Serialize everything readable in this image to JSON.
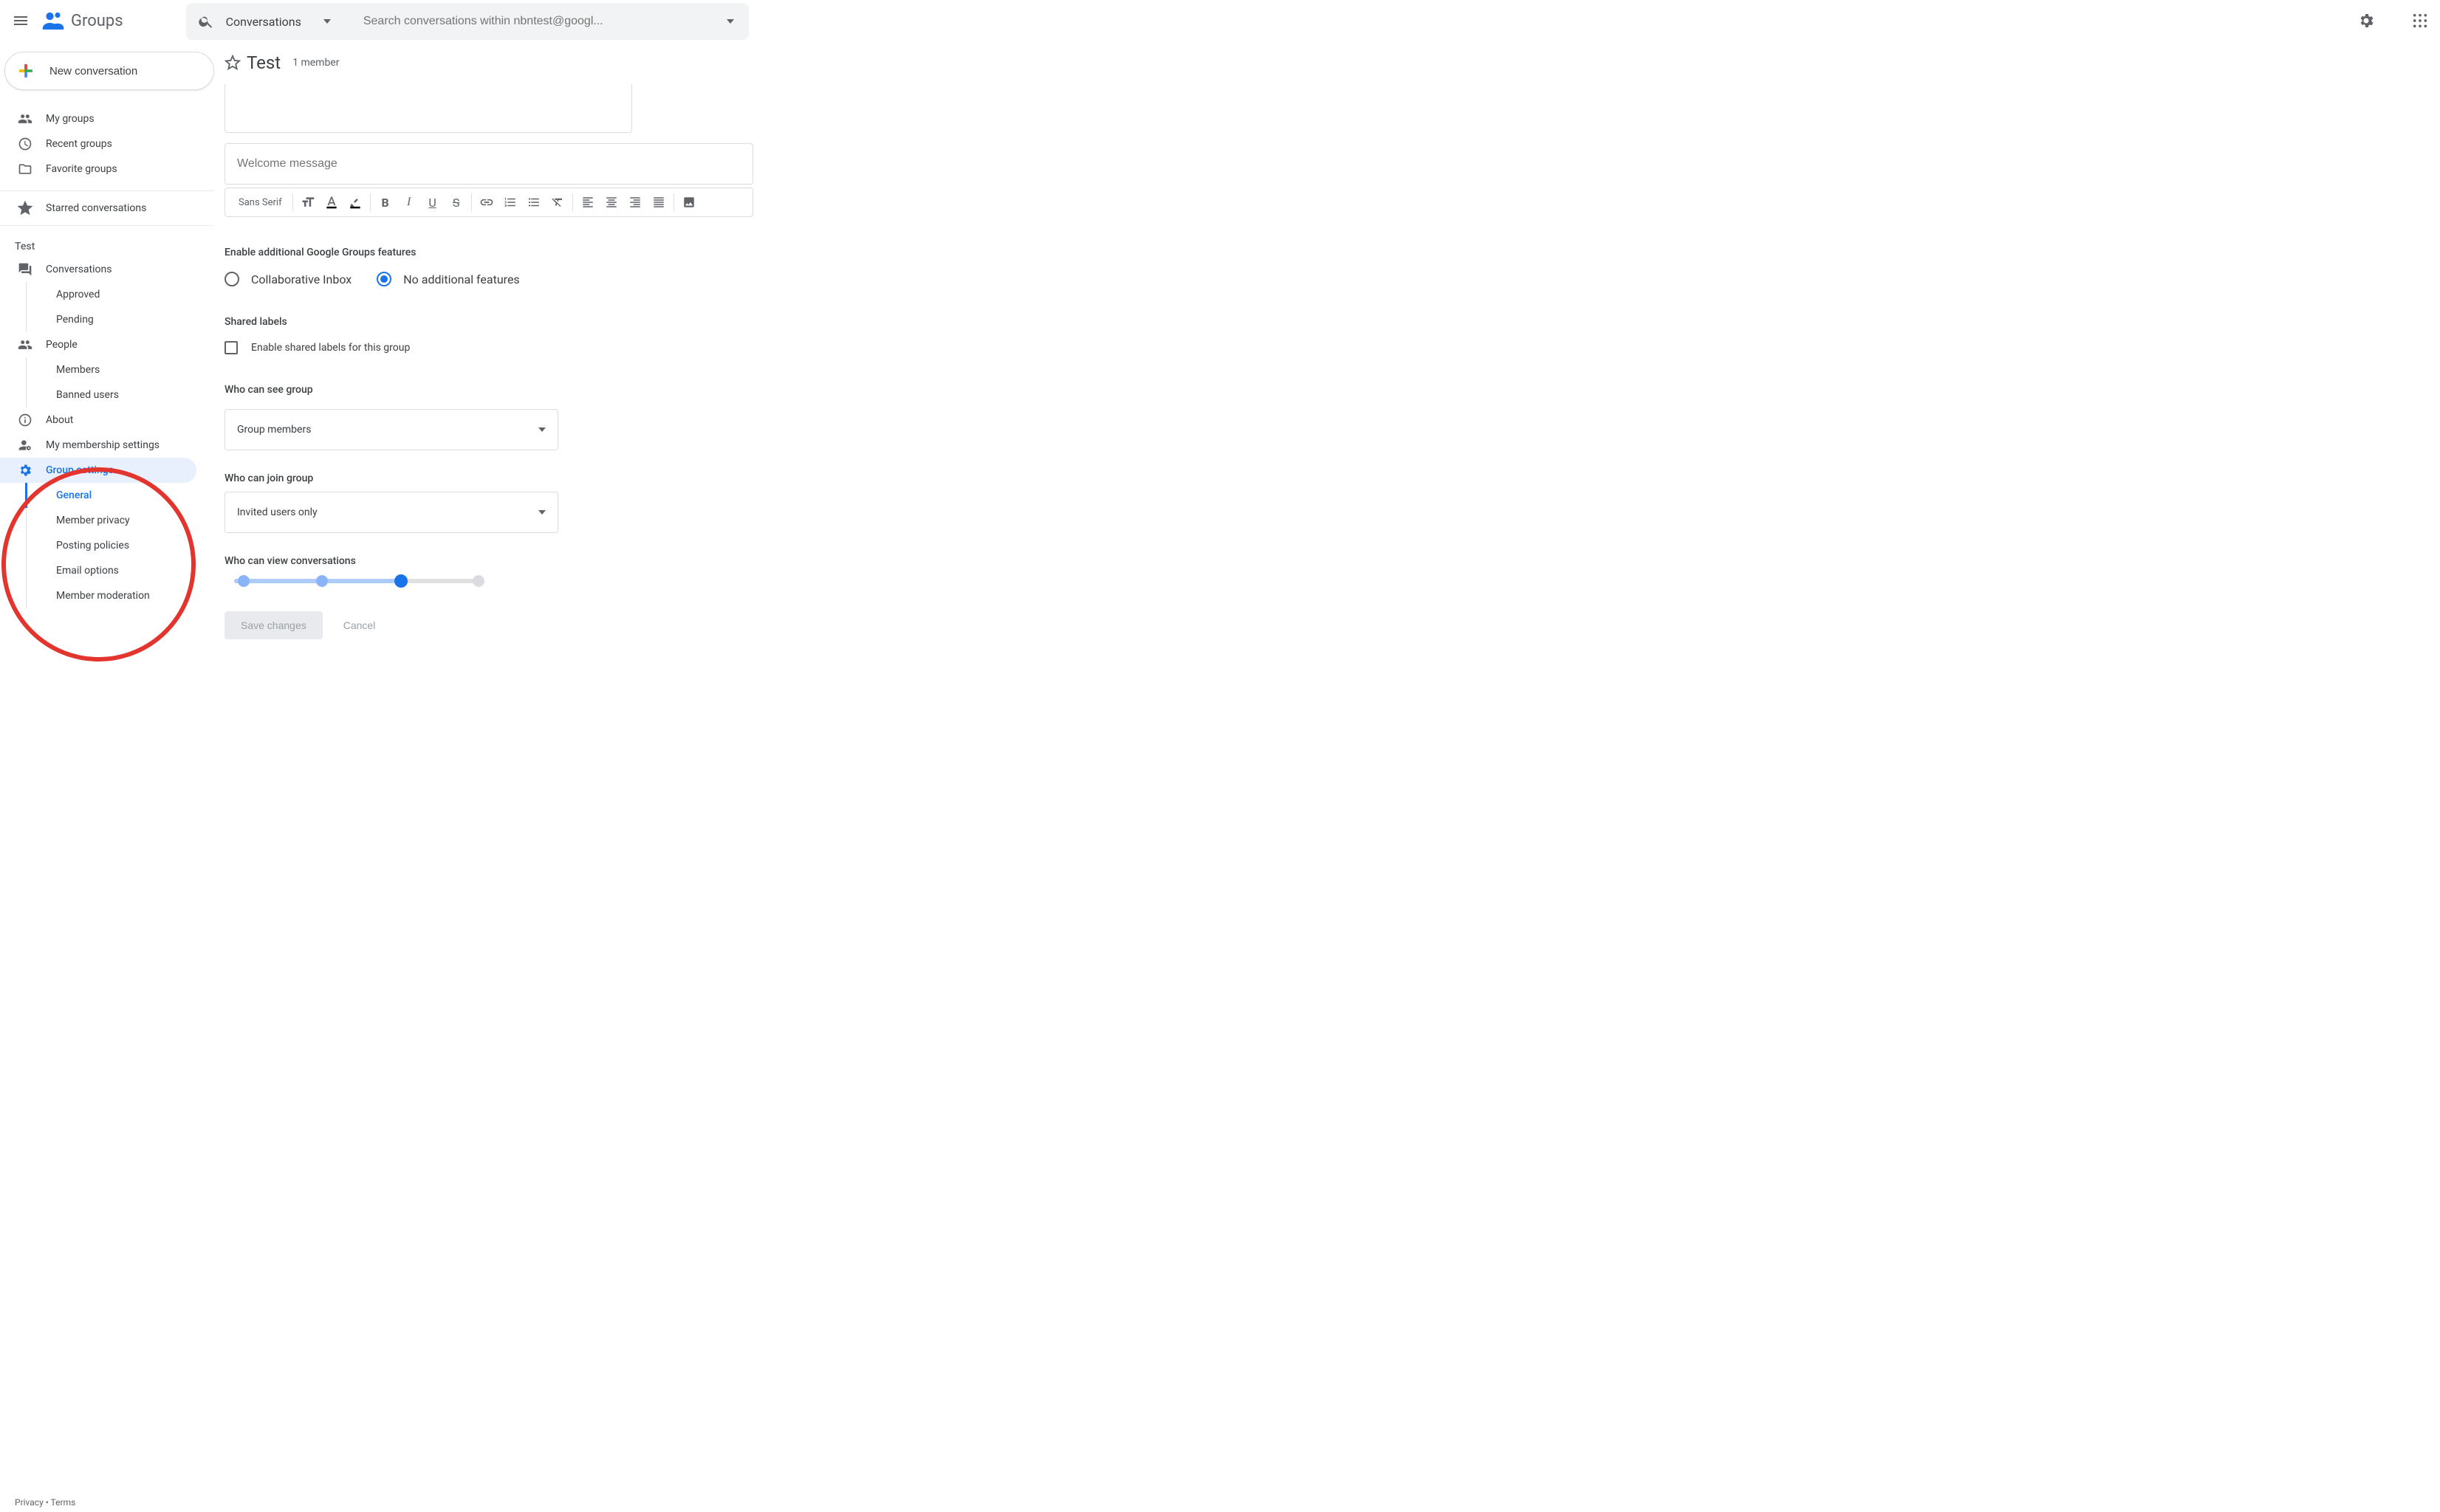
{
  "header": {
    "product_name": "Groups",
    "search_scope": "Conversations",
    "search_placeholder": "Search conversations within nbntest@googl..."
  },
  "sidebar": {
    "new_conversation_label": "New conversation",
    "top_items": [
      {
        "key": "my-groups",
        "label": "My groups",
        "icon": "people"
      },
      {
        "key": "recent-groups",
        "label": "Recent groups",
        "icon": "clock"
      },
      {
        "key": "favorite-groups",
        "label": "Favorite groups",
        "icon": "folder-star"
      }
    ],
    "starred_label": "Starred conversations",
    "group_section_header": "Test",
    "group_nav": {
      "conversations": "Conversations",
      "approved": "Approved",
      "pending": "Pending",
      "people": "People",
      "members": "Members",
      "banned_users": "Banned users",
      "about": "About",
      "my_membership": "My membership settings",
      "group_settings": "Group settings",
      "general": "General",
      "member_privacy": "Member privacy",
      "posting_policies": "Posting policies",
      "email_options": "Email options",
      "member_moderation": "Member moderation"
    }
  },
  "content": {
    "group_title": "Test",
    "member_count": "1 member",
    "welcome_placeholder": "Welcome message",
    "toolbar_font": "Sans Serif",
    "sections": {
      "features_heading": "Enable additional Google Groups features",
      "radio_collab": "Collaborative Inbox",
      "radio_none": "No additional features",
      "shared_labels_heading": "Shared labels",
      "shared_labels_checkbox": "Enable shared labels for this group",
      "who_see_heading": "Who can see group",
      "who_see_value": "Group members",
      "who_join_heading": "Who can join group",
      "who_join_value": "Invited users only",
      "who_view_conv_heading": "Who can view conversations"
    },
    "actions": {
      "save": "Save changes",
      "cancel": "Cancel"
    }
  },
  "footer": {
    "privacy": "Privacy",
    "separator": " • ",
    "terms": "Terms"
  },
  "colors": {
    "primary_blue": "#1a73e8",
    "annotation_red": "#e3352e"
  }
}
